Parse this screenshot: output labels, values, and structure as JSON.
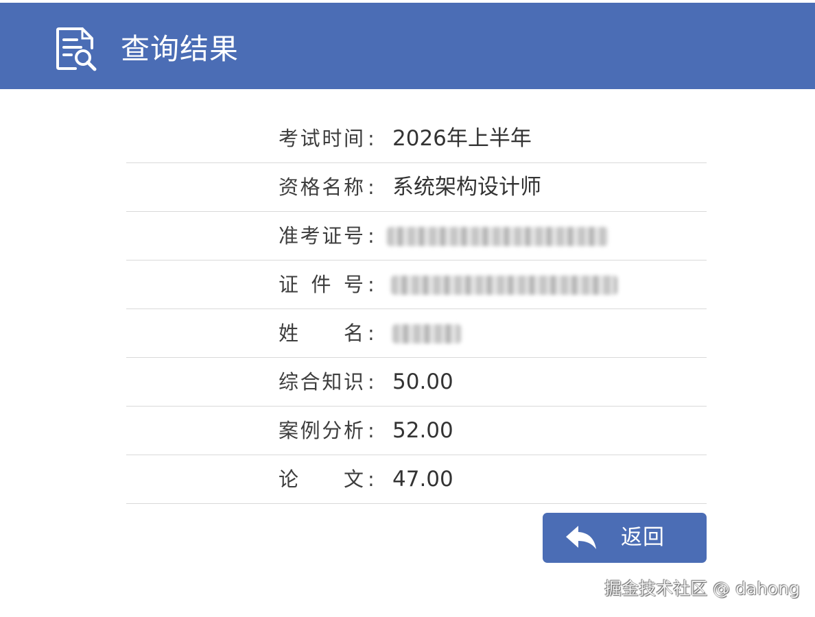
{
  "header": {
    "title": "查询结果",
    "icon": "document-search-icon"
  },
  "results": [
    {
      "label": "考试时间",
      "colon": ":",
      "value": "2026年上半年",
      "masked": false
    },
    {
      "label": "资格名称",
      "colon": ":",
      "value": "系统架构设计师",
      "masked": false
    },
    {
      "label": "准考证号",
      "colon": ":",
      "value": "",
      "masked": true
    },
    {
      "label": "证件号",
      "colon": ":",
      "value": "",
      "masked": true
    },
    {
      "label": "姓名",
      "colon": ":",
      "value": "",
      "masked": true
    },
    {
      "label": "综合知识",
      "colon": ":",
      "value": "50.00",
      "masked": false
    },
    {
      "label": "案例分析",
      "colon": ":",
      "value": "52.00",
      "masked": false
    },
    {
      "label": "论文",
      "colon": ":",
      "value": "47.00",
      "masked": false
    }
  ],
  "actions": {
    "back_label": "返回",
    "back_icon": "reply-arrow-icon"
  },
  "watermark": {
    "text": "掘金技术社区 @ dahong"
  },
  "colors": {
    "header_bg": "#4b6db5",
    "button_bg": "#4b6db5",
    "divider": "#d9d9d9",
    "text": "#333333"
  }
}
